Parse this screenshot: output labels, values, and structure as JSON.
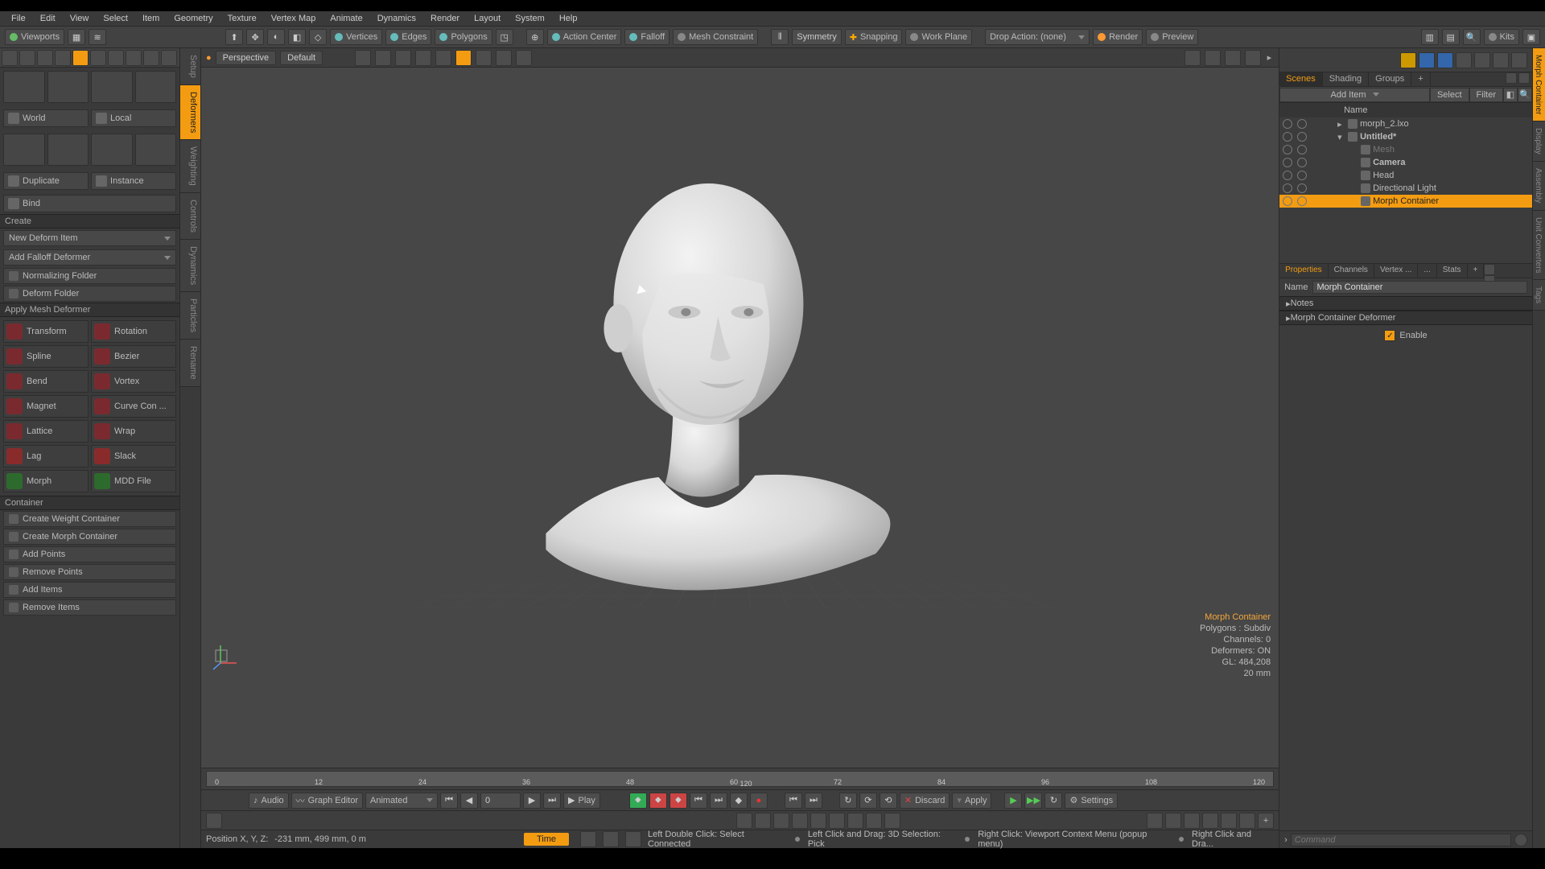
{
  "menu": [
    "File",
    "Edit",
    "View",
    "Select",
    "Item",
    "Geometry",
    "Texture",
    "Vertex Map",
    "Animate",
    "Dynamics",
    "Render",
    "Layout",
    "System",
    "Help"
  ],
  "toolbar": {
    "viewports": "Viewports",
    "sel_vertices": "Vertices",
    "sel_edges": "Edges",
    "sel_polygons": "Polygons",
    "action_center": "Action Center",
    "falloff": "Falloff",
    "mesh_constraint": "Mesh Constraint",
    "symmetry": "Symmetry",
    "snapping": "Snapping",
    "work_plane": "Work Plane",
    "drop_action": "Drop Action: (none)",
    "render": "Render",
    "preview": "Preview",
    "kits": "Kits"
  },
  "left": {
    "world": "World",
    "local": "Local",
    "duplicate": "Duplicate",
    "instance": "Instance",
    "bind": "Bind",
    "create": "Create",
    "new_deform": "New Deform Item",
    "add_falloff": "Add Falloff Deformer",
    "normalizing": "Normalizing Folder",
    "deform_folder": "Deform Folder",
    "apply_mesh_deformer": "Apply Mesh Deformer",
    "transform": "Transform",
    "rotation": "Rotation",
    "spline": "Spline",
    "bezier": "Bezier",
    "bend": "Bend",
    "vortex": "Vortex",
    "magnet": "Magnet",
    "curve_con": "Curve Con ...",
    "lattice": "Lattice",
    "wrap": "Wrap",
    "lag": "Lag",
    "slack": "Slack",
    "morph": "Morph",
    "mdd": "MDD File",
    "container": "Container",
    "create_weight": "Create Weight Container",
    "create_morph": "Create Morph Container",
    "add_points": "Add Points",
    "remove_points": "Remove Points",
    "add_items": "Add Items",
    "remove_items": "Remove Items",
    "vtabs": [
      "Setup",
      "Deformers",
      "Weighting",
      "Controls",
      "Dynamics",
      "Particles",
      "Rename"
    ]
  },
  "viewport": {
    "type": "Perspective",
    "shading": "Default",
    "overlay": {
      "l1": "Morph Container",
      "l2": "Polygons : Subdiv",
      "l3": "Channels: 0",
      "l4": "Deformers: ON",
      "l5": "GL: 484,208",
      "l6": "20 mm"
    }
  },
  "timeline": {
    "ticks": [
      "0",
      "12",
      "24",
      "36",
      "48",
      "60",
      "72",
      "84",
      "96",
      "108",
      "120"
    ],
    "sub": "120"
  },
  "playbar": {
    "audio": "Audio",
    "graph": "Graph Editor",
    "mode": "Animated",
    "frame": "0",
    "play": "Play",
    "discard": "Discard",
    "apply": "Apply",
    "settings": "Settings"
  },
  "status": {
    "pos_label": "Position X, Y, Z:",
    "pos_val": "-231 mm, 499 mm, 0 m",
    "time": "Time",
    "hint1": "Left Double Click: Select Connected",
    "hint2": "Left Click and Drag: 3D Selection: Pick",
    "hint3": "Right Click: Viewport Context Menu (popup menu)",
    "hint4": "Right Click and Dra..."
  },
  "scene": {
    "tabs": [
      "Scenes",
      "Shading",
      "Groups"
    ],
    "add_item": "Add Item",
    "select": "Select",
    "filter": "Filter",
    "name_col": "Name",
    "items": [
      {
        "indent": 0,
        "label": "morph_2.lxo",
        "icon": "doc",
        "bold": false,
        "exp": "▸"
      },
      {
        "indent": 0,
        "label": "Untitled*",
        "icon": "doc",
        "bold": true,
        "exp": "▾"
      },
      {
        "indent": 1,
        "label": "Mesh",
        "icon": "mesh",
        "dim": true
      },
      {
        "indent": 1,
        "label": "Camera",
        "icon": "cam",
        "bold": true
      },
      {
        "indent": 1,
        "label": "Head",
        "icon": "mesh"
      },
      {
        "indent": 1,
        "label": "Directional Light",
        "icon": "light"
      },
      {
        "indent": 1,
        "label": "Morph Container",
        "icon": "morph",
        "sel": true
      }
    ]
  },
  "props": {
    "tabs": [
      "Properties",
      "Channels",
      "Vertex ...",
      "...",
      "Stats"
    ],
    "name_label": "Name",
    "name_value": "Morph Container",
    "sect_notes": "Notes",
    "sect_deform": "Morph Container Deformer",
    "enable": "Enable"
  },
  "right_vtabs": [
    "Morph Container",
    "Display",
    "Assembly",
    "Unit Converters",
    "Tags"
  ],
  "command_placeholder": "Command"
}
